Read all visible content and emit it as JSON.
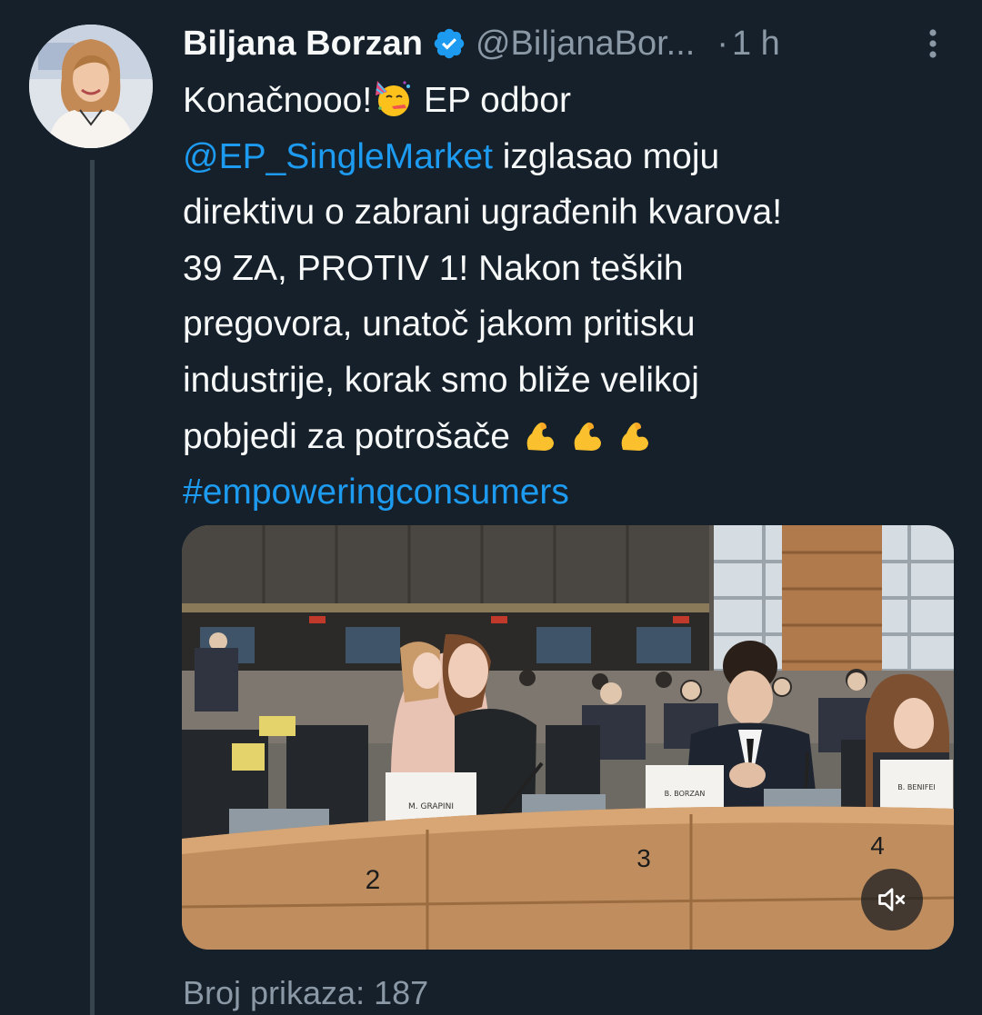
{
  "author": {
    "display_name": "Biljana Borzan",
    "handle": "@BiljanaBor...",
    "separator": "·",
    "time": "1 h",
    "verified": true
  },
  "tweet": {
    "line1_text": "Konačnooo!",
    "line1_after": " EP odbor",
    "mention": "@EP_SingleMarket",
    "line2_after": " izglasao moju",
    "line3": "direktivu o zabrani ugrađenih kvarova!",
    "line4": "39 ZA, PROTIV 1! Nakon teških",
    "line5": "pregovora, unatoč jakom pritisku",
    "line6": "industrije, korak smo bliže velikoj",
    "line7": "pobjedi za potrošače",
    "hashtag": "#empoweringconsumers",
    "emojis": [
      "partying-face",
      "flexed-biceps",
      "flexed-biceps",
      "flexed-biceps"
    ]
  },
  "media": {
    "type": "video",
    "nameplates": [
      "M. GRAPINI",
      "B. BORZAN",
      "B. BENIFEI"
    ],
    "seat_numbers": [
      "2",
      "3",
      "4"
    ],
    "muted": true
  },
  "views": {
    "label": "Broj prikaza: 187"
  },
  "colors": {
    "background": "#15202b",
    "text": "#f7f9f9",
    "secondary": "#8b98a5",
    "accent": "#1d9bf0",
    "thread_line": "#38444d"
  }
}
